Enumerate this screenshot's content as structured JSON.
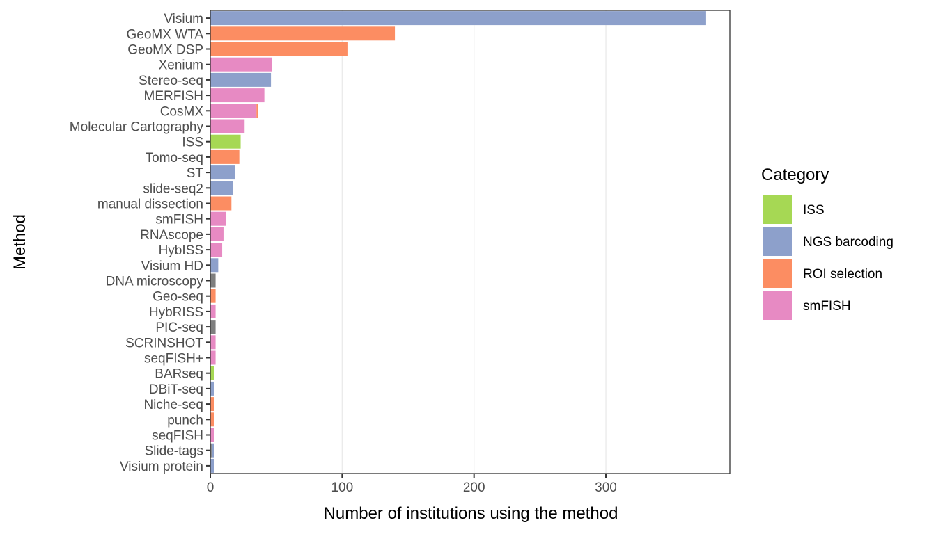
{
  "chart_data": {
    "type": "bar",
    "orientation": "horizontal",
    "stacked": true,
    "title": "",
    "xlabel": "Number of institutions using the method",
    "ylabel": "Method",
    "xlim": [
      0,
      394
    ],
    "xticks": [
      0,
      100,
      200,
      300
    ],
    "grid": "vertical-major",
    "legend": {
      "title": "Category",
      "placement": "right",
      "entries": [
        {
          "name": "ISS",
          "color": "#A6D854"
        },
        {
          "name": "NGS barcoding",
          "color": "#8DA0CB"
        },
        {
          "name": "ROI selection",
          "color": "#FC8D62"
        },
        {
          "name": "smFISH",
          "color": "#E78AC3"
        }
      ]
    },
    "na_color": "#7F7F7F",
    "categories": [
      "Visium",
      "GeoMX WTA",
      "GeoMX DSP",
      "Xenium",
      "Stereo-seq",
      "MERFISH",
      "CosMX",
      "Molecular Cartography",
      "ISS",
      "Tomo-seq",
      "ST",
      "slide-seq2",
      "manual dissection",
      "smFISH",
      "RNAscope",
      "HybISS",
      "Visium HD",
      "DNA microscopy",
      "Geo-seq",
      "HybRISS",
      "PIC-seq",
      "SCRINSHOT",
      "seqFISH+",
      "BARseq",
      "DBiT-seq",
      "Niche-seq",
      "punch",
      "seqFISH",
      "Slide-tags",
      "Visium protein"
    ],
    "series": [
      {
        "name": "ISS",
        "values": [
          0,
          0,
          0,
          0,
          0,
          0,
          0,
          0,
          23,
          0,
          0,
          0,
          0,
          0,
          0,
          0,
          0,
          0,
          0,
          0,
          0,
          0,
          0,
          3,
          0,
          0,
          0,
          0,
          0,
          0
        ]
      },
      {
        "name": "NGS barcoding",
        "values": [
          376,
          0,
          0,
          0,
          46,
          0,
          0,
          0,
          0,
          0,
          19,
          17,
          0,
          0,
          0,
          0,
          6,
          0,
          0,
          0,
          0,
          0,
          0,
          0,
          3,
          0,
          0,
          0,
          2,
          3
        ]
      },
      {
        "name": "ROI selection",
        "values": [
          0,
          140,
          104,
          0,
          0,
          0,
          1,
          0,
          0,
          22,
          0,
          0,
          16,
          0,
          0,
          0,
          0,
          0,
          4,
          0,
          0,
          0,
          0,
          0,
          0,
          3,
          3,
          0,
          0,
          0
        ]
      },
      {
        "name": "smFISH",
        "values": [
          0,
          0,
          0,
          47,
          0,
          41,
          35,
          26,
          0,
          0,
          0,
          0,
          0,
          12,
          10,
          9,
          0,
          0,
          0,
          4,
          0,
          4,
          4,
          0,
          0,
          0,
          0,
          3,
          0,
          0
        ]
      },
      {
        "name": "NA",
        "values": [
          0,
          0,
          0,
          0,
          0,
          0,
          0,
          0,
          0,
          0,
          0,
          0,
          0,
          0,
          0,
          0,
          0,
          4,
          0,
          0,
          4,
          0,
          0,
          0,
          0,
          0,
          0,
          0,
          1,
          0
        ]
      }
    ]
  }
}
